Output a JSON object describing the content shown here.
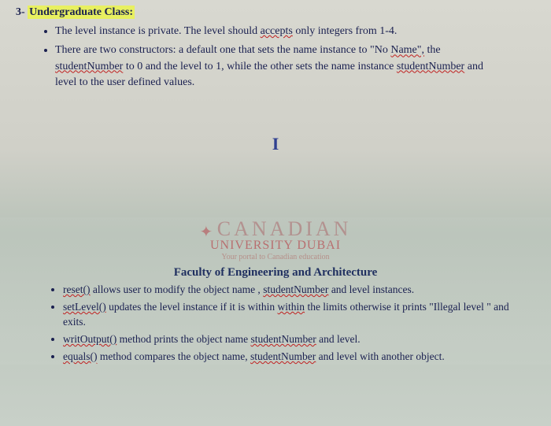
{
  "top": {
    "heading_prefix": "3-",
    "heading_text": "Undergraduate Class:",
    "bullet1_a": "The level instance is private. The level should ",
    "bullet1_b": "accepts",
    "bullet1_c": " only integers from 1-4.",
    "bullet2_a": "There are two constructors: a default one that sets the name instance to \"No ",
    "bullet2_b": "Name\",",
    "bullet2_c": " the ",
    "bullet2_d": "studentNumber",
    "bullet2_e": " to 0  and the level to 1, while  the other sets the name instance ",
    "bullet2_f": "studentNumber",
    "bullet2_g": " and level to the user defined values."
  },
  "cursor": "I",
  "logo": {
    "line1": "CANADIAN",
    "line2": "UNIVERSITY DUBAI",
    "line3": "Your portal to Canadian education"
  },
  "faculty": "Faculty of Engineering and Architecture",
  "methods": {
    "m1_a": "reset()",
    "m1_b": " allows user to modify the object name , ",
    "m1_c": "studentNumber",
    "m1_d": " and level instances.",
    "m2_a": "setLevel()",
    "m2_b": " updates the level instance if it is within ",
    "m2_c": "within",
    "m2_d": " the limits otherwise it prints \"Illegal level \" and exits.",
    "m3_a": "writOutput()",
    "m3_b": " method prints the object name ",
    "m3_c": "studentNumber",
    "m3_d": " and level.",
    "m4_a": "equals()",
    "m4_b": " method compares the object name, ",
    "m4_c": "studentNumber",
    "m4_d": " and level with another object."
  }
}
